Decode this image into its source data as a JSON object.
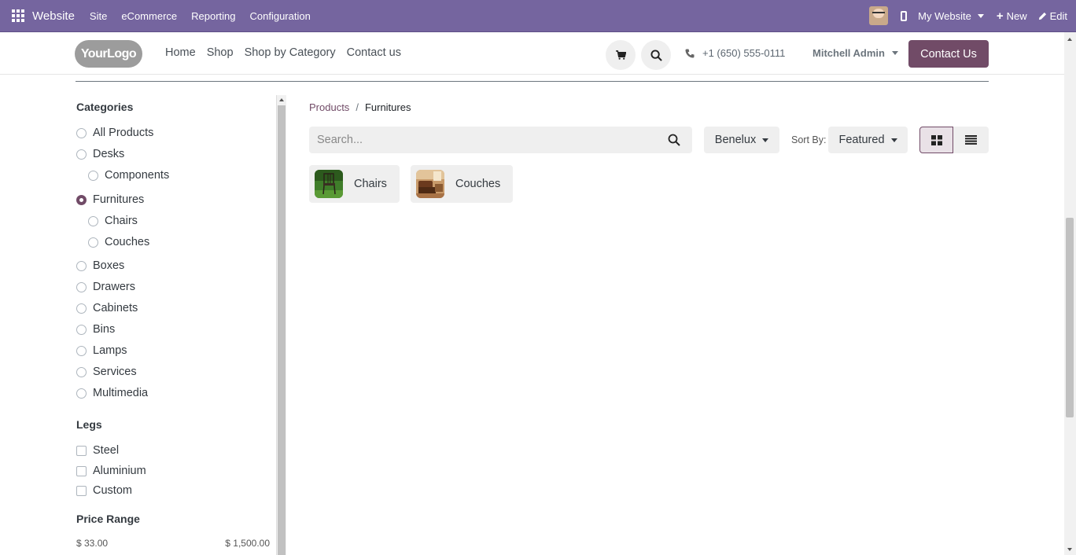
{
  "adminbar": {
    "app_name": "Website",
    "menu": [
      "Site",
      "eCommerce",
      "Reporting",
      "Configuration"
    ],
    "website_label": "My Website",
    "new_label": "New",
    "edit_label": "Edit"
  },
  "header": {
    "logo_text": "YourLogo",
    "nav": [
      "Home",
      "Shop",
      "Shop by Category",
      "Contact us"
    ],
    "phone": "+1 (650) 555-0111",
    "user": "Mitchell Admin",
    "contact_button": "Contact Us"
  },
  "sidebar": {
    "categories_title": "Categories",
    "categories": [
      {
        "label": "All Products",
        "selected": false,
        "level": 0
      },
      {
        "label": "Desks",
        "selected": false,
        "level": 0
      },
      {
        "label": "Components",
        "selected": false,
        "level": 1
      },
      {
        "label": "Furnitures",
        "selected": true,
        "level": 0
      },
      {
        "label": "Chairs",
        "selected": false,
        "level": 1
      },
      {
        "label": "Couches",
        "selected": false,
        "level": 1
      },
      {
        "label": "Boxes",
        "selected": false,
        "level": 0
      },
      {
        "label": "Drawers",
        "selected": false,
        "level": 0
      },
      {
        "label": "Cabinets",
        "selected": false,
        "level": 0
      },
      {
        "label": "Bins",
        "selected": false,
        "level": 0
      },
      {
        "label": "Lamps",
        "selected": false,
        "level": 0
      },
      {
        "label": "Services",
        "selected": false,
        "level": 0
      },
      {
        "label": "Multimedia",
        "selected": false,
        "level": 0
      }
    ],
    "legs_title": "Legs",
    "legs": [
      "Steel",
      "Aluminium",
      "Custom"
    ],
    "price_title": "Price Range",
    "price_min": "$ 33.00",
    "price_max": "$ 1,500.00"
  },
  "main": {
    "breadcrumb": [
      "Products",
      "Furnitures"
    ],
    "search_placeholder": "Search...",
    "pricelist": "Benelux",
    "sort_label": "Sort By:",
    "sort_value": "Featured",
    "subcategories": [
      "Chairs",
      "Couches"
    ]
  },
  "colors": {
    "adminbar": "#75659f",
    "primary": "#714b67"
  }
}
